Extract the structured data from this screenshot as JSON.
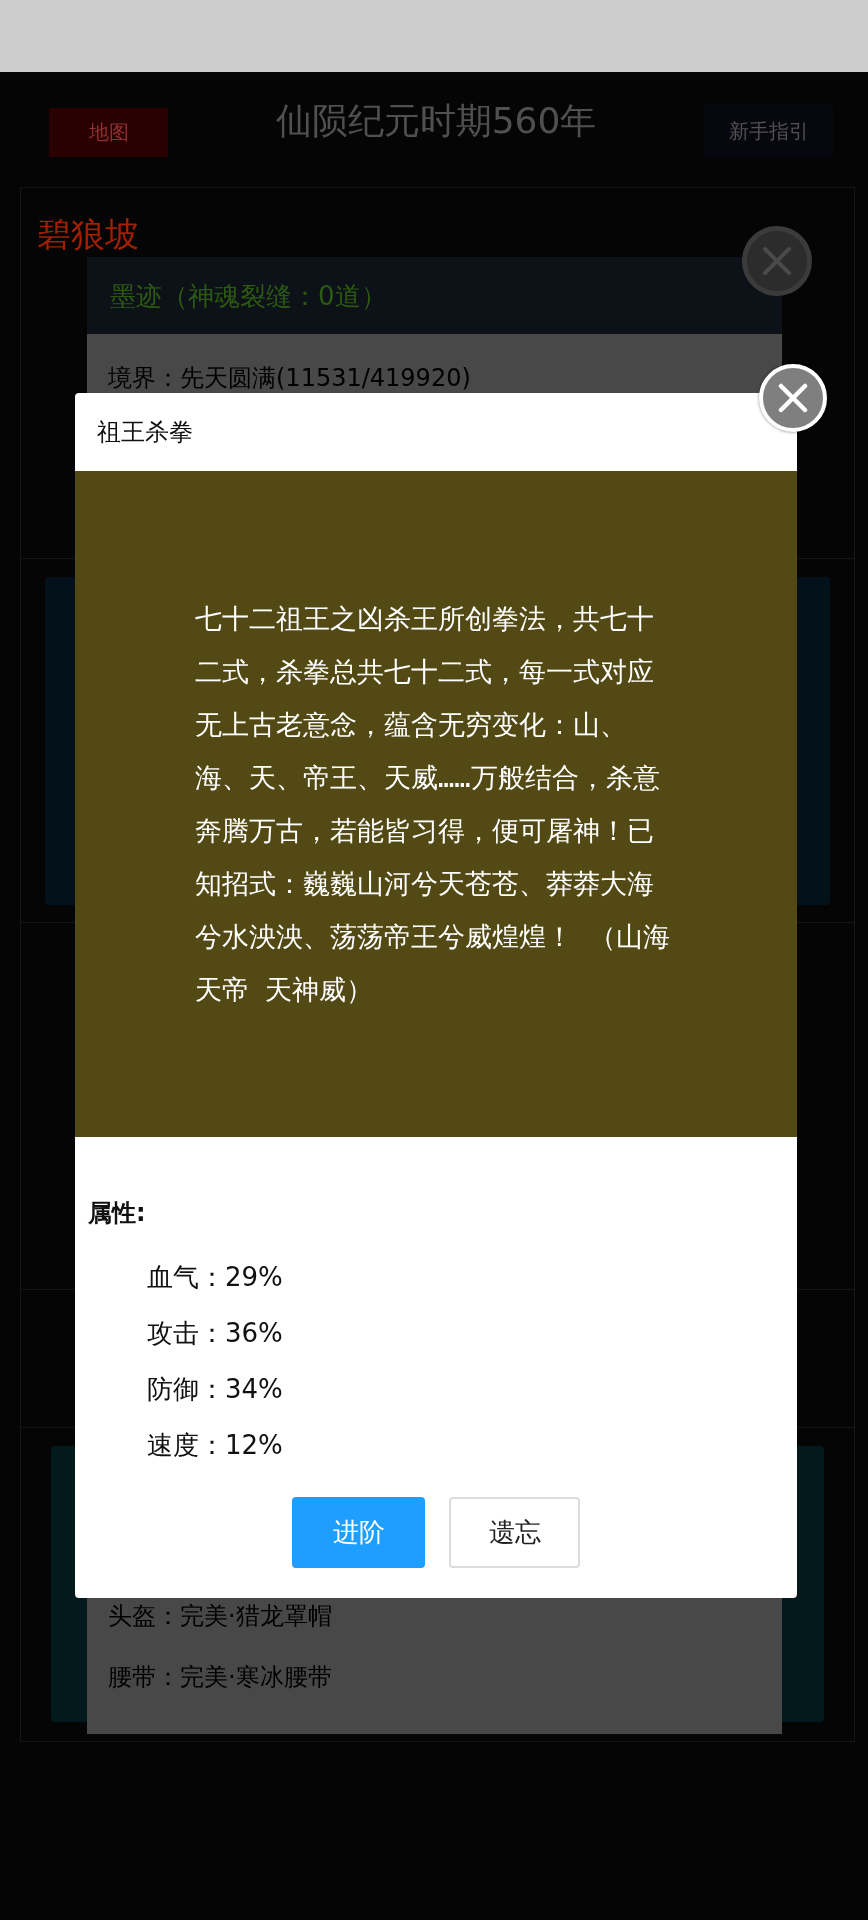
{
  "header": {
    "map_button": "地图",
    "title": "仙陨纪元时期560年",
    "guide_button": "新手指引"
  },
  "location": {
    "name": "碧狼坡"
  },
  "character_dialog": {
    "title": "墨迹（神魂裂缝：0道）",
    "realm": "境界：先天圆满(11531/419920)",
    "equipment": [
      "头盔：完美·猎龙罩帽",
      "腰带：完美·寒冰腰带"
    ]
  },
  "skill_dialog": {
    "title": "祖王杀拳",
    "description": "七十二祖王之凶杀王所创拳法，共七十二式，杀拳总共七十二式，每一式对应无上古老意念，蕴含无穷变化：山、海、天、帝王、天威……万般结合，杀意奔腾万古，若能皆习得，便可屠神！已知招式：巍巍山河兮天苍苍、莽莽大海兮水泱泱、荡荡帝王兮威煌煌！ （山海天帝 天神威）",
    "attributes_heading": "属性:",
    "attributes": [
      "血气：29%",
      "攻击：36%",
      "防御：34%",
      "速度：12%"
    ],
    "buttons": [
      {
        "label": "进阶",
        "kind": "primary"
      },
      {
        "label": "遗忘",
        "kind": "secondary"
      }
    ]
  }
}
